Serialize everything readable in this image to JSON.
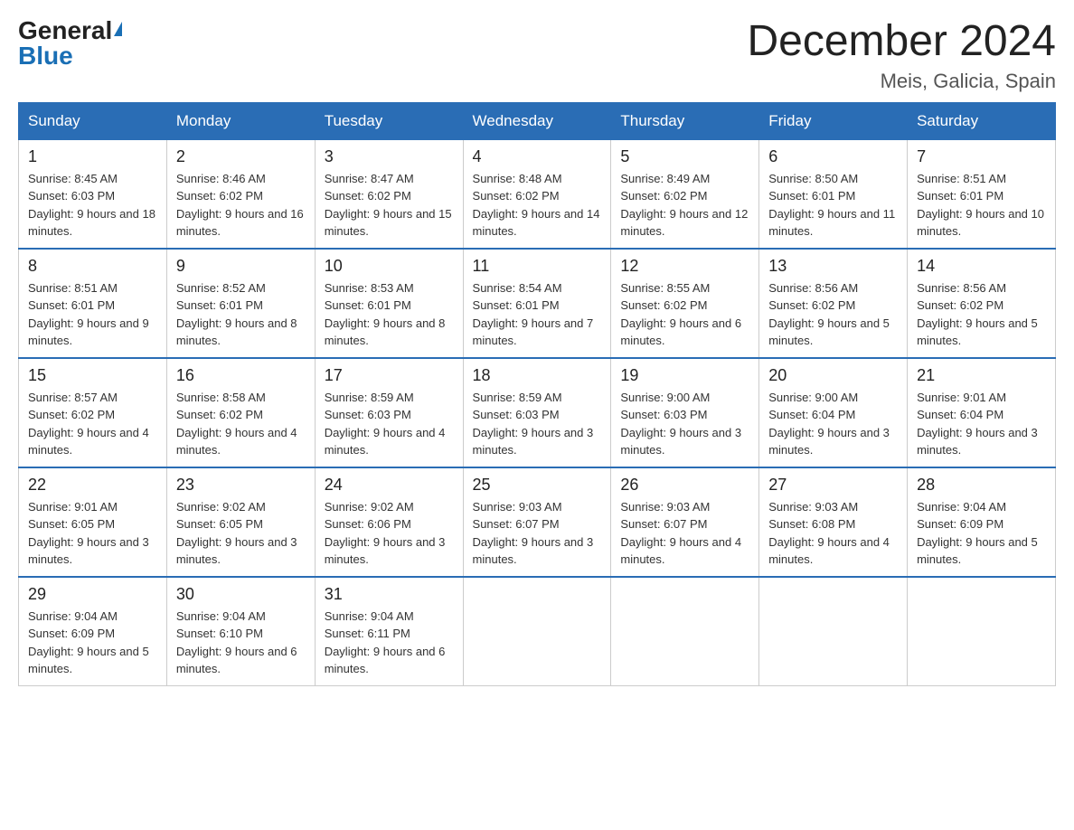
{
  "header": {
    "logo_general": "General",
    "logo_blue": "Blue",
    "month_year": "December 2024",
    "location": "Meis, Galicia, Spain"
  },
  "weekdays": [
    "Sunday",
    "Monday",
    "Tuesday",
    "Wednesday",
    "Thursday",
    "Friday",
    "Saturday"
  ],
  "weeks": [
    [
      {
        "day": "1",
        "sunrise": "8:45 AM",
        "sunset": "6:03 PM",
        "daylight": "9 hours and 18 minutes."
      },
      {
        "day": "2",
        "sunrise": "8:46 AM",
        "sunset": "6:02 PM",
        "daylight": "9 hours and 16 minutes."
      },
      {
        "day": "3",
        "sunrise": "8:47 AM",
        "sunset": "6:02 PM",
        "daylight": "9 hours and 15 minutes."
      },
      {
        "day": "4",
        "sunrise": "8:48 AM",
        "sunset": "6:02 PM",
        "daylight": "9 hours and 14 minutes."
      },
      {
        "day": "5",
        "sunrise": "8:49 AM",
        "sunset": "6:02 PM",
        "daylight": "9 hours and 12 minutes."
      },
      {
        "day": "6",
        "sunrise": "8:50 AM",
        "sunset": "6:01 PM",
        "daylight": "9 hours and 11 minutes."
      },
      {
        "day": "7",
        "sunrise": "8:51 AM",
        "sunset": "6:01 PM",
        "daylight": "9 hours and 10 minutes."
      }
    ],
    [
      {
        "day": "8",
        "sunrise": "8:51 AM",
        "sunset": "6:01 PM",
        "daylight": "9 hours and 9 minutes."
      },
      {
        "day": "9",
        "sunrise": "8:52 AM",
        "sunset": "6:01 PM",
        "daylight": "9 hours and 8 minutes."
      },
      {
        "day": "10",
        "sunrise": "8:53 AM",
        "sunset": "6:01 PM",
        "daylight": "9 hours and 8 minutes."
      },
      {
        "day": "11",
        "sunrise": "8:54 AM",
        "sunset": "6:01 PM",
        "daylight": "9 hours and 7 minutes."
      },
      {
        "day": "12",
        "sunrise": "8:55 AM",
        "sunset": "6:02 PM",
        "daylight": "9 hours and 6 minutes."
      },
      {
        "day": "13",
        "sunrise": "8:56 AM",
        "sunset": "6:02 PM",
        "daylight": "9 hours and 5 minutes."
      },
      {
        "day": "14",
        "sunrise": "8:56 AM",
        "sunset": "6:02 PM",
        "daylight": "9 hours and 5 minutes."
      }
    ],
    [
      {
        "day": "15",
        "sunrise": "8:57 AM",
        "sunset": "6:02 PM",
        "daylight": "9 hours and 4 minutes."
      },
      {
        "day": "16",
        "sunrise": "8:58 AM",
        "sunset": "6:02 PM",
        "daylight": "9 hours and 4 minutes."
      },
      {
        "day": "17",
        "sunrise": "8:59 AM",
        "sunset": "6:03 PM",
        "daylight": "9 hours and 4 minutes."
      },
      {
        "day": "18",
        "sunrise": "8:59 AM",
        "sunset": "6:03 PM",
        "daylight": "9 hours and 3 minutes."
      },
      {
        "day": "19",
        "sunrise": "9:00 AM",
        "sunset": "6:03 PM",
        "daylight": "9 hours and 3 minutes."
      },
      {
        "day": "20",
        "sunrise": "9:00 AM",
        "sunset": "6:04 PM",
        "daylight": "9 hours and 3 minutes."
      },
      {
        "day": "21",
        "sunrise": "9:01 AM",
        "sunset": "6:04 PM",
        "daylight": "9 hours and 3 minutes."
      }
    ],
    [
      {
        "day": "22",
        "sunrise": "9:01 AM",
        "sunset": "6:05 PM",
        "daylight": "9 hours and 3 minutes."
      },
      {
        "day": "23",
        "sunrise": "9:02 AM",
        "sunset": "6:05 PM",
        "daylight": "9 hours and 3 minutes."
      },
      {
        "day": "24",
        "sunrise": "9:02 AM",
        "sunset": "6:06 PM",
        "daylight": "9 hours and 3 minutes."
      },
      {
        "day": "25",
        "sunrise": "9:03 AM",
        "sunset": "6:07 PM",
        "daylight": "9 hours and 3 minutes."
      },
      {
        "day": "26",
        "sunrise": "9:03 AM",
        "sunset": "6:07 PM",
        "daylight": "9 hours and 4 minutes."
      },
      {
        "day": "27",
        "sunrise": "9:03 AM",
        "sunset": "6:08 PM",
        "daylight": "9 hours and 4 minutes."
      },
      {
        "day": "28",
        "sunrise": "9:04 AM",
        "sunset": "6:09 PM",
        "daylight": "9 hours and 5 minutes."
      }
    ],
    [
      {
        "day": "29",
        "sunrise": "9:04 AM",
        "sunset": "6:09 PM",
        "daylight": "9 hours and 5 minutes."
      },
      {
        "day": "30",
        "sunrise": "9:04 AM",
        "sunset": "6:10 PM",
        "daylight": "9 hours and 6 minutes."
      },
      {
        "day": "31",
        "sunrise": "9:04 AM",
        "sunset": "6:11 PM",
        "daylight": "9 hours and 6 minutes."
      },
      null,
      null,
      null,
      null
    ]
  ]
}
